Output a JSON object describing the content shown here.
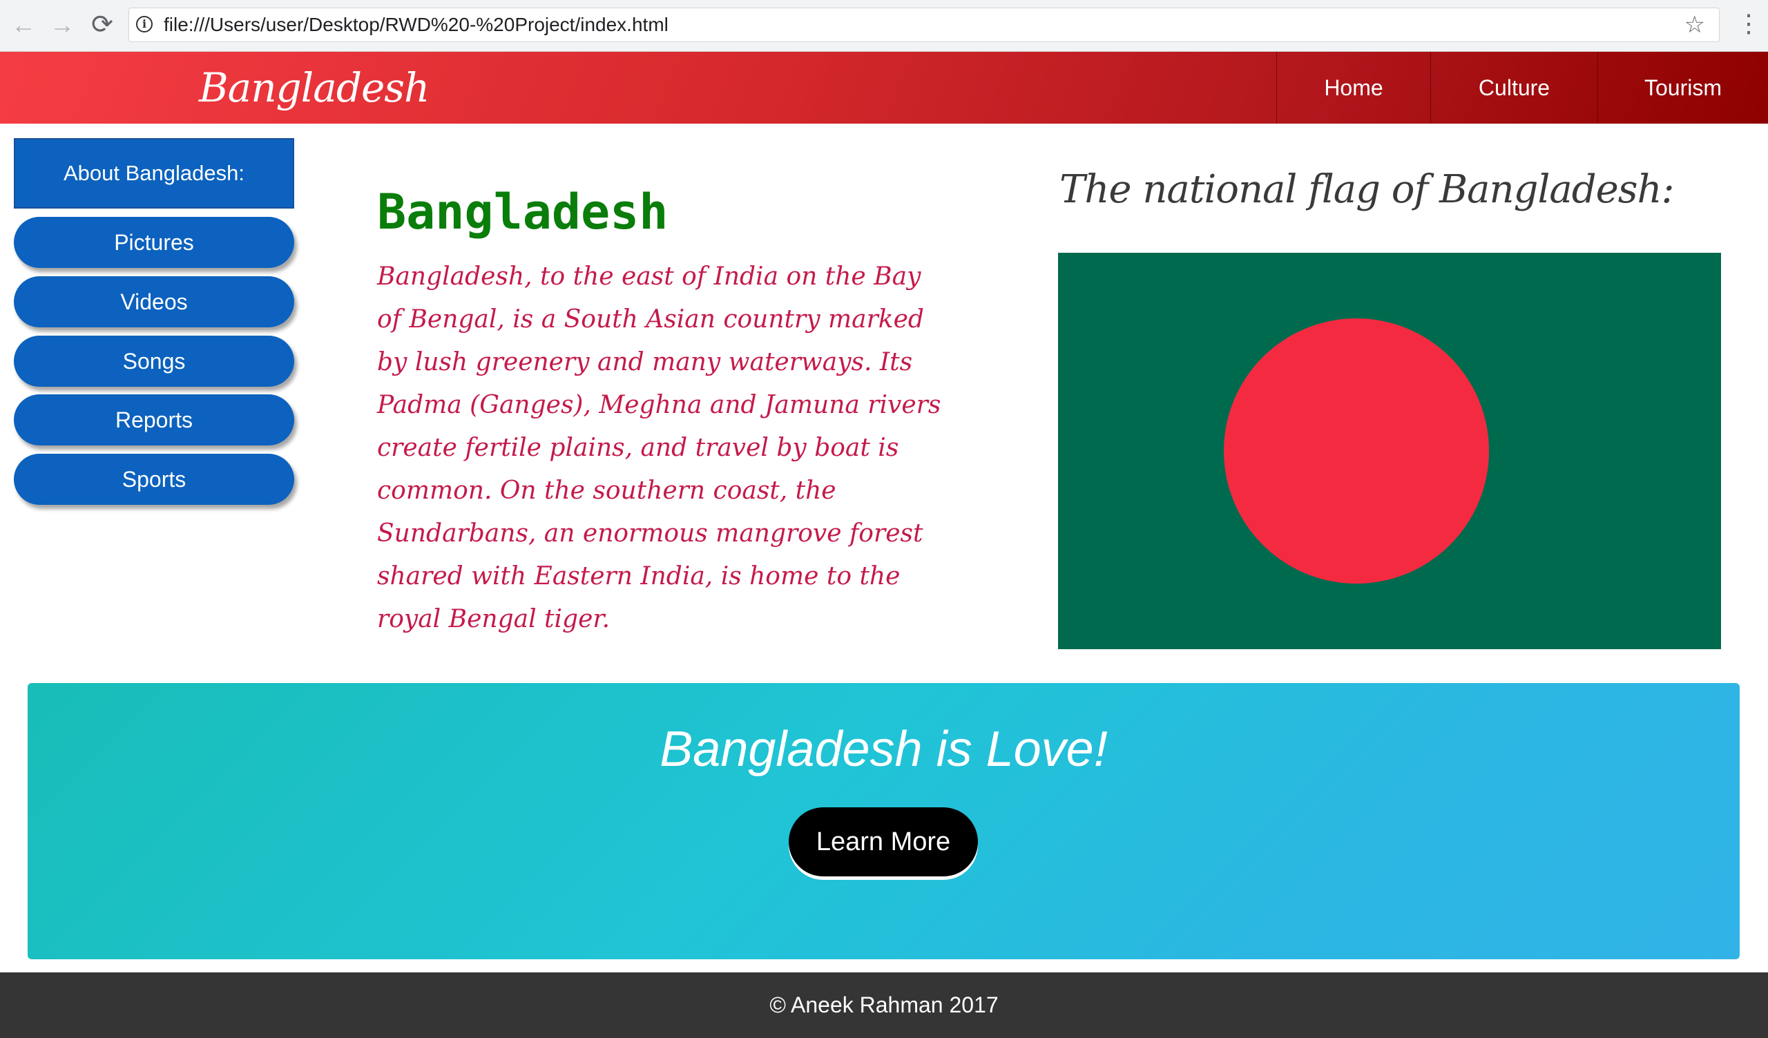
{
  "browser": {
    "back_icon": "←",
    "forward_icon": "→",
    "reload_icon": "⟳",
    "url": "file:///Users/user/Desktop/RWD%20-%20Project/index.html",
    "info_icon": "i",
    "star_icon": "☆",
    "menu_icon": "⋮"
  },
  "header": {
    "brand": "Bangladesh",
    "nav": [
      "Home",
      "Culture",
      "Tourism"
    ]
  },
  "sidebar": {
    "heading": "About Bangladesh:",
    "items": [
      "Pictures",
      "Videos",
      "Songs",
      "Reports",
      "Sports"
    ]
  },
  "article": {
    "title": "Bangladesh",
    "body": "Bangladesh, to the east of India on the Bay of Bengal, is a South Asian country marked by lush greenery and many waterways. Its Padma (Ganges), Meghna and Jamuna rivers create fertile plains, and travel by boat is common. On the southern coast, the Sundarbans, an enormous mangrove forest shared with Eastern India, is home to the royal Bengal tiger."
  },
  "flag_section": {
    "heading": "The national flag of Bangladesh:",
    "flag_green": "#006a4e",
    "flag_red": "#f42a41"
  },
  "banner": {
    "title": "Bangladesh is Love!",
    "button": "Learn More"
  },
  "footer": {
    "text": "© Aneek Rahman 2017"
  },
  "colors": {
    "header_start": "#f53c44",
    "header_end": "#8e0000",
    "sidebar_blue": "#0c62be",
    "title_green": "#0a7d0a",
    "body_crimson": "#c41a4a",
    "banner_teal": "#20c4d6",
    "footer_bg": "#353535"
  }
}
